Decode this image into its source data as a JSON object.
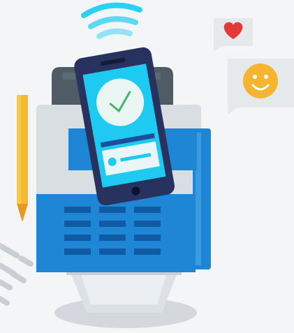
{
  "illustration": {
    "subject": "contactless-payment-terminal",
    "colors": {
      "background": "#f3f5f7",
      "terminal_body": "#d9dee3",
      "terminal_top": "#4f5c66",
      "keypad_panel": "#1f86d6",
      "keypad_keys": "#0f5aa3",
      "phone_body": "#27325e",
      "phone_screen": "#1ec9f2",
      "phone_card": "#1d4e9b",
      "check_mark": "#44b56a",
      "wifi_signal": "#2ad1f2",
      "pencil": "#f5b82e",
      "heart": "#e53935",
      "smiley": "#f6b531",
      "bubble": "#e6e9ec",
      "pedestal_shadow": "#d4d8dc",
      "stand_light": "#eceff2",
      "receipt_lines": "#c9ced3"
    },
    "icons": [
      "wifi-signal-icon",
      "check-icon",
      "heart-icon",
      "smiley-icon",
      "pencil-icon"
    ]
  }
}
